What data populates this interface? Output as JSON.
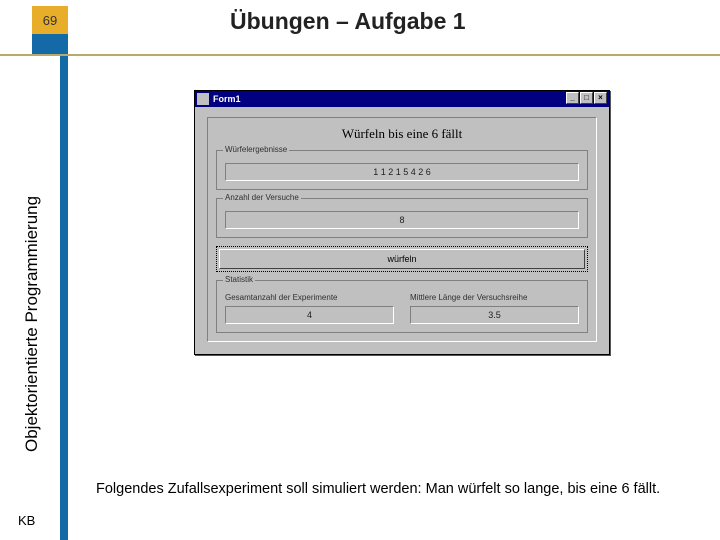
{
  "slide": {
    "number": "69",
    "title": "Übungen – Aufgabe 1",
    "sidebar": "Objektorientierte Programmierung",
    "footer": "KB",
    "description": "Folgendes Zufallsexperiment soll simuliert werden: Man würfelt so lange, bis eine 6 fällt."
  },
  "window": {
    "title": "Form1",
    "btn_min": "_",
    "btn_max": "□",
    "btn_close": "×",
    "caption": "Würfeln bis eine 6 fällt",
    "group_result_label": "Würfelergebnisse",
    "group_result_value": "1 1 2 1 5 4 2 6",
    "group_attempts_label": "Anzahl der Versuche",
    "group_attempts_value": "8",
    "action_button": "würfeln",
    "group_stats_label": "Statistik",
    "stat_experiments_label": "Gesamtanzahl der Experimente",
    "stat_experiments_value": "4",
    "stat_mean_label": "Mittlere Länge der Versuchsreihe",
    "stat_mean_value": "3.5"
  }
}
